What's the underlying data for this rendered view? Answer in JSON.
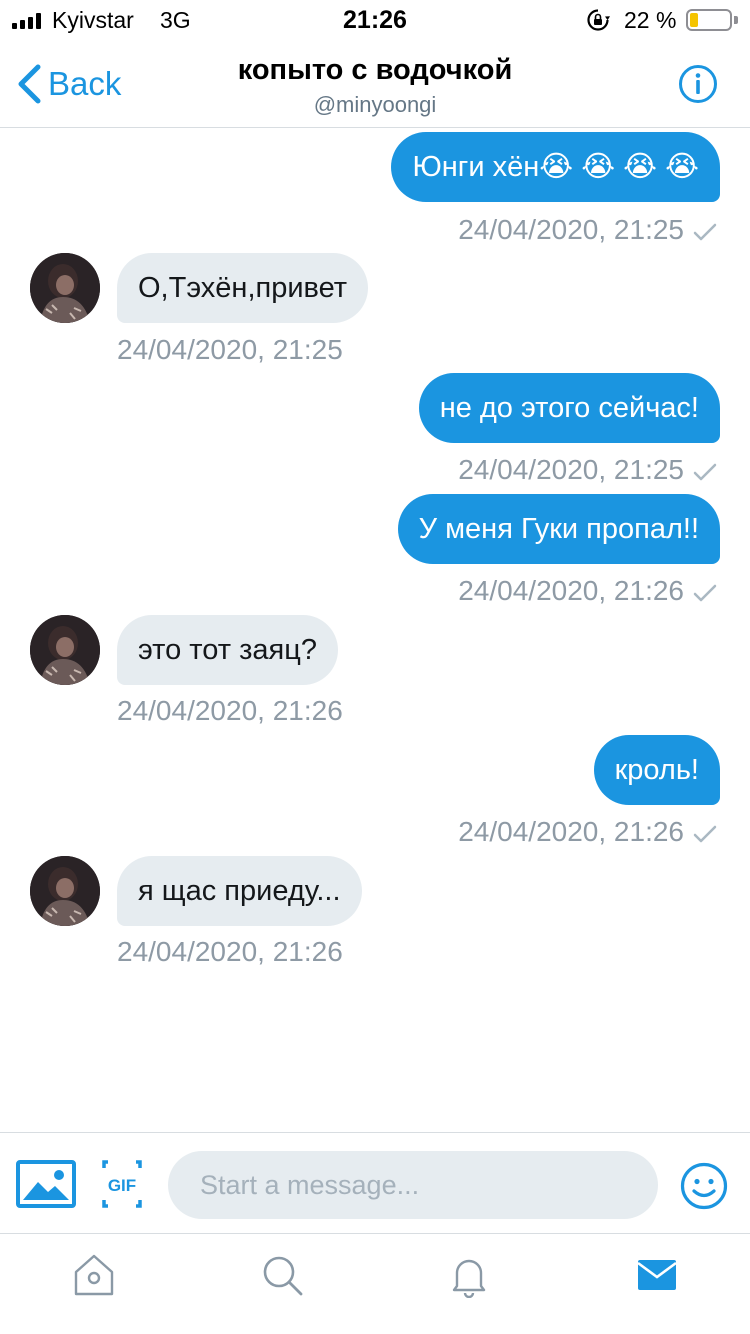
{
  "status_bar": {
    "carrier": "Kyivstar",
    "network": "3G",
    "time": "21:26",
    "battery_percent": "22 %",
    "battery_level": 0.22,
    "battery_color": "#f5c400"
  },
  "header": {
    "back_label": "Back",
    "title": "копыто с водочкой",
    "handle": "@minyoongi",
    "info_icon": "info-icon"
  },
  "messages": [
    {
      "direction": "out",
      "text": "Юнги хён😭 😭 😭 😭",
      "timestamp": "24/04/2020, 21:25"
    },
    {
      "direction": "in",
      "text": "О,Тэхён,привет",
      "timestamp": "24/04/2020, 21:25"
    },
    {
      "direction": "out",
      "text": "не до этого сейчас!",
      "timestamp": "24/04/2020, 21:25"
    },
    {
      "direction": "out",
      "text": "У меня Гуки пропал!!",
      "timestamp": "24/04/2020, 21:26"
    },
    {
      "direction": "in",
      "text": "это тот заяц?",
      "timestamp": "24/04/2020, 21:26"
    },
    {
      "direction": "out",
      "text": "кроль!",
      "timestamp": "24/04/2020, 21:26"
    },
    {
      "direction": "in",
      "text": "я щас приеду...",
      "timestamp": "24/04/2020, 21:26"
    }
  ],
  "composer": {
    "placeholder": "Start a message...",
    "photo_icon": "image-icon",
    "gif_label": "GIF",
    "emoji_icon": "smiley-icon"
  },
  "tabbar": {
    "tabs": [
      "home-icon",
      "search-icon",
      "bell-icon",
      "mail-icon"
    ],
    "active": "mail-icon"
  },
  "colors": {
    "accent": "#1b95e0",
    "incoming_bubble": "#e6ecf0",
    "timestamp": "#8e9aa5"
  }
}
